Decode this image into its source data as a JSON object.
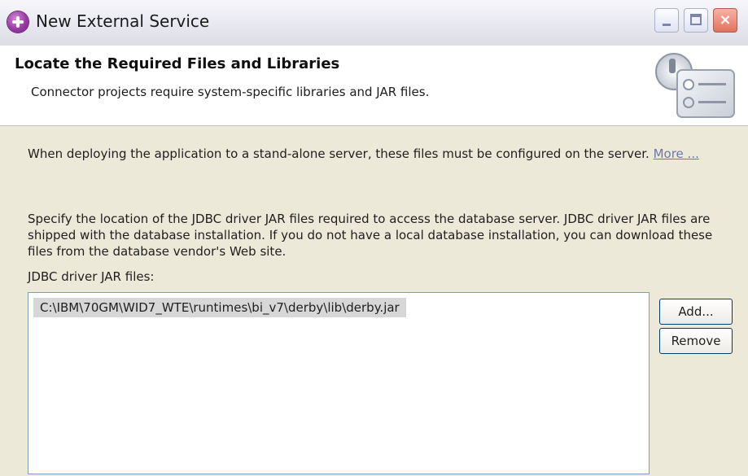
{
  "window": {
    "title": "New External Service",
    "controls": {
      "minimize": "minimize-icon",
      "maximize": "maximize-icon",
      "close": "close-icon"
    }
  },
  "header": {
    "title": "Locate the Required Files and Libraries",
    "description": "Connector projects require system-specific libraries and JAR files.",
    "graphic": "wizard-banner-icon"
  },
  "body": {
    "paragraph1": "When deploying the application to a stand-alone server, these files must be configured on the server.",
    "more_link": "More ...",
    "paragraph2": "Specify the location of the JDBC driver JAR files required to access the database server. JDBC driver JAR files are shipped with the database installation. If you do not have a local database installation, you can download these files from the database vendor's Web site.",
    "list_label": "JDBC driver JAR files:",
    "jar_files": [
      "C:\\IBM\\70GM\\WID7_WTE\\runtimes\\bi_v7\\derby\\lib\\derby.jar"
    ],
    "buttons": {
      "add": "Add...",
      "remove": "Remove"
    }
  },
  "colors": {
    "link": "#6a7aa8",
    "selection": "#d7d7d7",
    "dialog_bg": "#ece9d8"
  }
}
